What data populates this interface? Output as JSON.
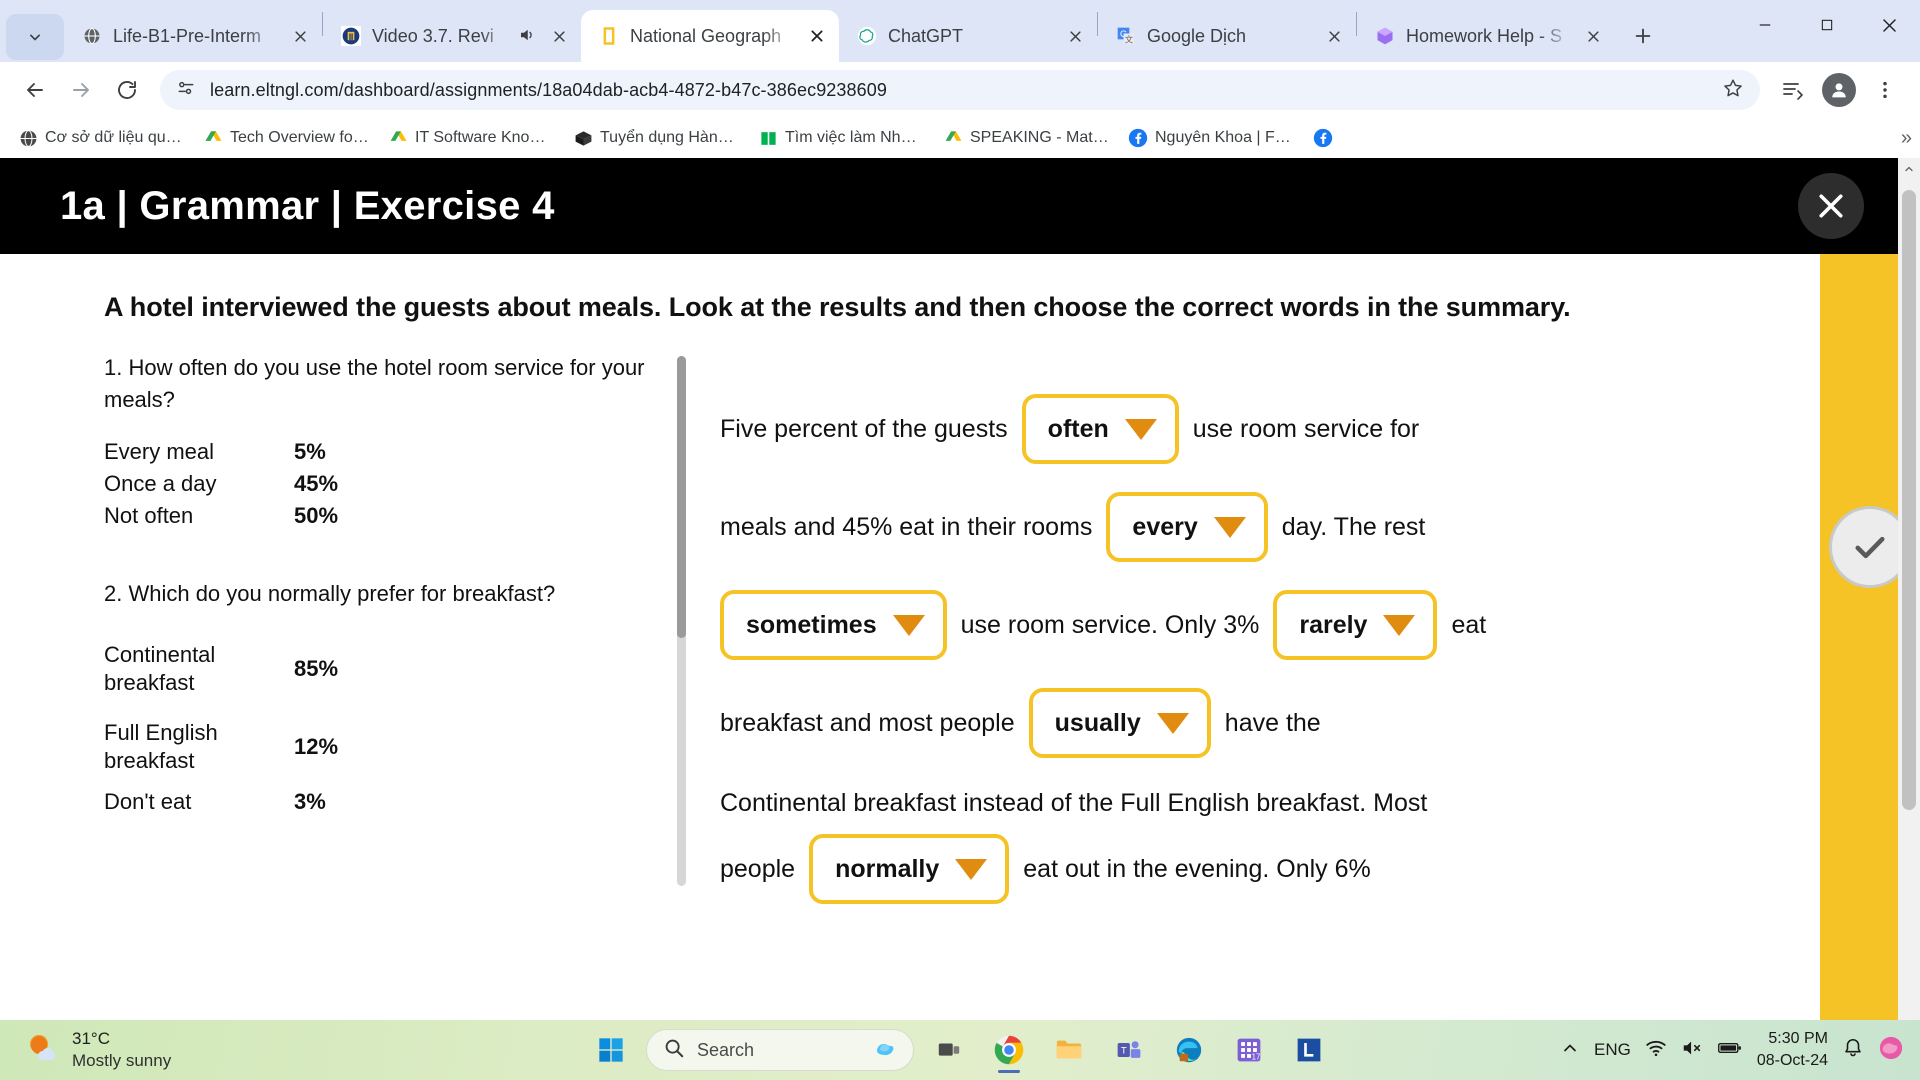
{
  "browser": {
    "tabs": [
      {
        "title": "Life-B1-Pre-Interm",
        "favicon": "globe-icon",
        "active": false,
        "audio": false
      },
      {
        "title": "Video 3.7. Revi",
        "favicon": "university-crest-icon",
        "active": false,
        "audio": true
      },
      {
        "title": "National Geograph",
        "favicon": "natgeo-rectangle-icon",
        "active": true,
        "audio": false
      },
      {
        "title": "ChatGPT",
        "favicon": "openai-icon",
        "active": false,
        "audio": false
      },
      {
        "title": "Google Dịch",
        "favicon": "google-translate-icon",
        "active": false,
        "audio": false
      },
      {
        "title": "Homework Help - S",
        "favicon": "homework-hex-icon",
        "active": false,
        "audio": false
      }
    ],
    "new_tab_label": "+",
    "window_controls": {
      "minimize": "minimize-icon",
      "maximize": "maximize-icon",
      "close": "close-icon"
    },
    "toolbar": {
      "back": "back-arrow-icon",
      "forward": "forward-arrow-icon",
      "reload": "reload-icon",
      "site_info": "site-settings-icon",
      "url": "learn.eltngl.com/dashboard/assignments/18a04dab-acb4-4872-b47c-386ec9238609",
      "bookmark_star": "star-icon",
      "reading_list": "reading-list-icon",
      "profile": "profile-avatar-icon",
      "menu": "three-dot-menu-icon"
    },
    "bookmarks": [
      {
        "label": "Cơ sở dữ liệu quốc...",
        "icon": "globe-dark-icon"
      },
      {
        "label": "Tech Overview for H...",
        "icon": "google-drive-icon"
      },
      {
        "label": "IT Software Knowle...",
        "icon": "google-drive-icon"
      },
      {
        "label": "Tuyển dụng Hành c...",
        "icon": "box-icon"
      },
      {
        "label": "Tìm việc làm Nhân s...",
        "icon": "green-book-icon"
      },
      {
        "label": "SPEAKING - Mat Cla...",
        "icon": "google-drive-icon"
      },
      {
        "label": "Nguyên Khoa | Face...",
        "icon": "facebook-icon"
      },
      {
        "label": "",
        "icon": "facebook-icon"
      }
    ],
    "bookmarks_overflow": "»"
  },
  "exercise": {
    "title": "1a | Grammar | Exercise 4",
    "close_label": "×",
    "prompt": "A hotel interviewed the guests about meals. Look at the results and then choose the correct words in the summary.",
    "check_button": "submit-check-button"
  },
  "survey": [
    {
      "question": "1. How often do you use the hotel room service for your meals?",
      "rows": [
        {
          "label": "Every meal",
          "pct": "5%"
        },
        {
          "label": "Once a day",
          "pct": "45%"
        },
        {
          "label": "Not often",
          "pct": "50%"
        }
      ]
    },
    {
      "question": "2. Which do you normally prefer for breakfast?",
      "rows": [
        {
          "label": "Continental breakfast",
          "pct": "85%"
        },
        {
          "label": "Full English breakfast",
          "pct": "12%"
        },
        {
          "label": "Don't eat",
          "pct": "3%"
        }
      ]
    }
  ],
  "summary_lines": [
    {
      "pre": "Five percent of the guests",
      "gap": "often",
      "post": "use room service for"
    },
    {
      "pre": "meals and 45% eat in their rooms",
      "gap": "every",
      "post": "day. The rest"
    },
    {
      "pre": "",
      "gap": "sometimes",
      "post": "use room service. Only 3%",
      "gap2": "rarely",
      "post2": "eat"
    },
    {
      "pre": "breakfast and most people",
      "gap": "usually",
      "post": "have the"
    },
    {
      "pre": "Continental breakfast instead of the Full English breakfast. Most",
      "gap": "",
      "post": ""
    },
    {
      "pre": "people",
      "gap": "normally",
      "post": "eat out in the evening. Only 6%"
    }
  ],
  "taskbar": {
    "weather": {
      "temp": "31°C",
      "condition": "Mostly sunny",
      "icon": "sun-cloud-icon"
    },
    "start": "windows-start-icon",
    "search_placeholder": "Search",
    "search_icon": "search-icon",
    "apps": [
      {
        "name": "copilot-icon"
      },
      {
        "name": "task-view-icon"
      },
      {
        "name": "chrome-icon",
        "active": true
      },
      {
        "name": "file-explorer-icon"
      },
      {
        "name": "microsoft-teams-icon"
      },
      {
        "name": "microsoft-edge-icon"
      },
      {
        "name": "calendar-17-icon"
      },
      {
        "name": "lightshot-l-icon"
      }
    ],
    "tray": {
      "chevron": "show-hidden-icons-icon",
      "language": "ENG",
      "wifi": "wifi-icon",
      "volume": "volume-muted-icon",
      "battery": "battery-icon",
      "time": "5:30 PM",
      "date": "08-Oct-24",
      "notification": "notification-icon"
    }
  },
  "colors": {
    "accent_yellow": "#f5c326",
    "caret_orange": "#e08c10",
    "header_black": "#000000",
    "chrome_blue": "#dee5f7"
  }
}
